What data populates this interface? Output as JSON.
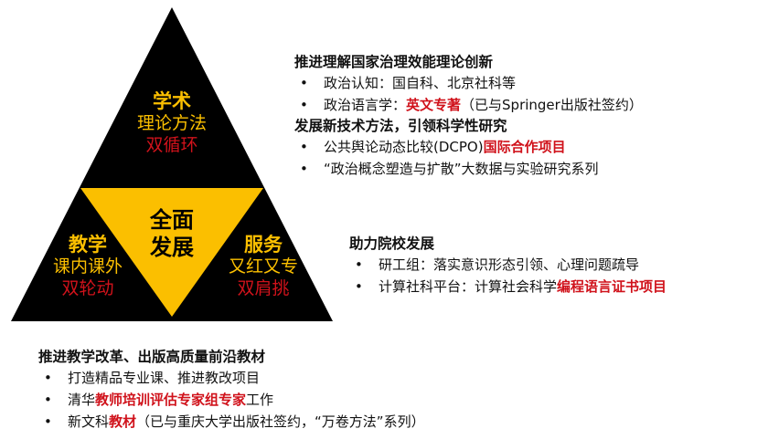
{
  "triangle": {
    "colors": {
      "outer": "#000000",
      "inner": "#fbbf00",
      "gold_text": "#fbbf00",
      "red_text": "#d0121b"
    },
    "top": {
      "title": "学术",
      "line": "理论方法",
      "red": "双循环"
    },
    "left": {
      "title": "教学",
      "line": "课内课外",
      "red": "双轮动"
    },
    "right": {
      "title": "服务",
      "line": "又红又专",
      "red": "双肩挑"
    },
    "center": {
      "line1": "全面",
      "line2": "发展"
    }
  },
  "research": {
    "heading1": "推进理解国家治理效能理论创新",
    "item1": "政治认知：国自科、北京社科等",
    "item2_pre": "政治语言学：",
    "item2_red": "英文专著",
    "item2_post": "（已与Springer出版社签约）",
    "heading2": "发展新技术方法，引领科学性研究",
    "item3_pre": "公共舆论动态比较(DCPO)",
    "item3_red": "国际合作项目",
    "item4": "“政治概念塑造与扩散”大数据与实验研究系列"
  },
  "service": {
    "heading": "助力院校发展",
    "item1": "研工组：落实意识形态引领、心理问题疏导",
    "item2_pre": "计算社科平台：计算社会科学",
    "item2_red": "编程语言证书项目"
  },
  "teaching": {
    "heading": "推进教学改革、出版高质量前沿教材",
    "item1": "打造精品专业课、推进教改项目",
    "item2_pre": "清华",
    "item2_red": "教师培训评估专家组专家",
    "item2_post": "工作",
    "item3_pre": "新文科",
    "item3_red": "教材",
    "item3_post": "（已与重庆大学出版社签约，“万卷方法”系列）"
  },
  "bullet": "•"
}
